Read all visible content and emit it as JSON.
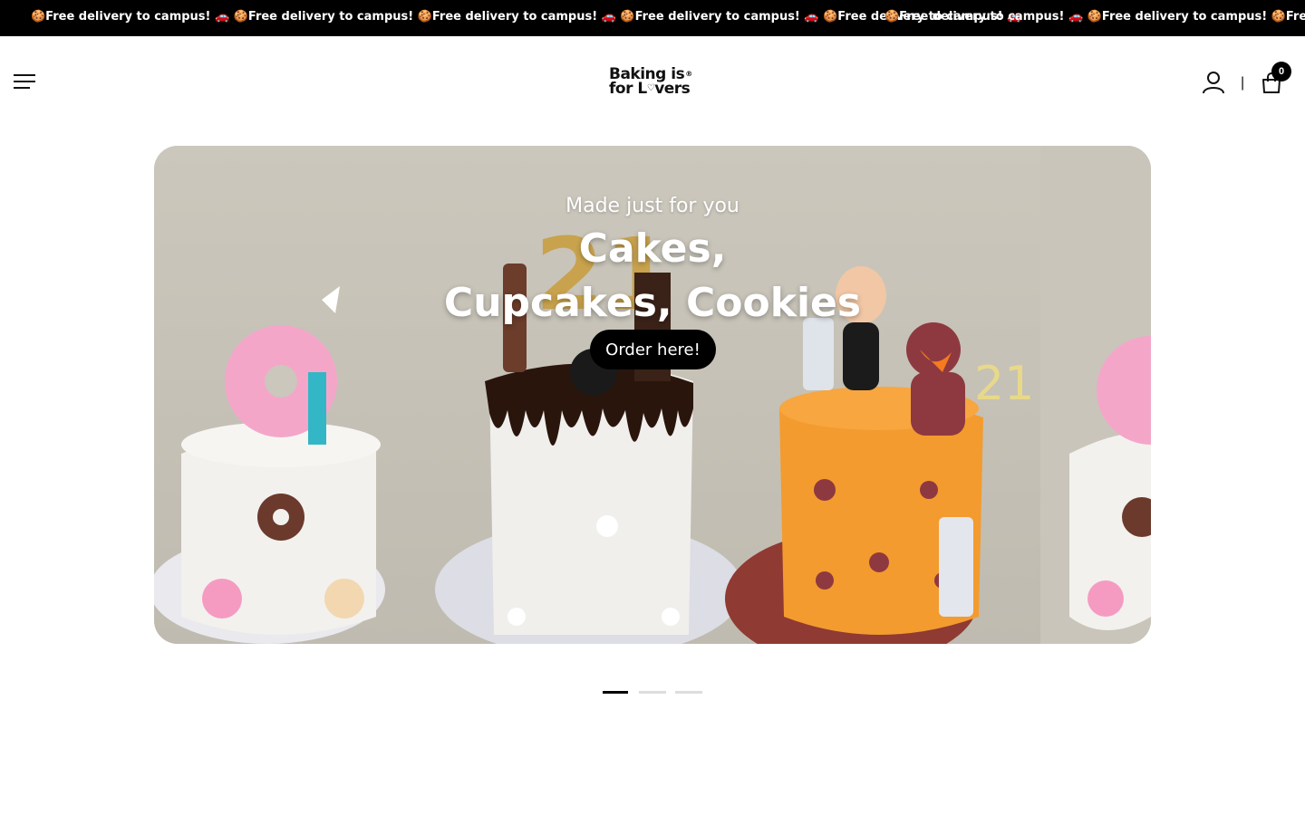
{
  "announcement": {
    "text_a": "🍪Free delivery to campus! 🚗 🍪Free delivery to campus! 🍪Free delivery to campus! 🚗 🍪Free delivery to campus! 🚗 🍪Free delivery to campus! 🚗",
    "text_b": "🍪Free delivery to campus! 🚗 🍪Free delivery to campus! 🍪Free delivery to c"
  },
  "header": {
    "logo_line1": "Baking is",
    "logo_reg": "®",
    "logo_line2_pre": "for L",
    "logo_heart": "♡",
    "logo_line2_post": "vers",
    "divider": "|",
    "cart_count": "0"
  },
  "hero": {
    "subtitle": "Made just for you",
    "title_line1": "Cakes,",
    "title_line2": "Cupcakes, Cookies",
    "cta_label": "Order here!"
  },
  "slider": {
    "active_index": 0,
    "total": 3
  },
  "colors": {
    "announcement_bg": "#000000",
    "hero_bg": "#c9c5ba",
    "accent": "#000000"
  }
}
